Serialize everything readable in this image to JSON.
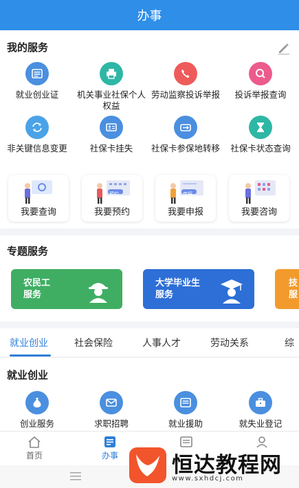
{
  "header": {
    "title": "办事"
  },
  "my_services": {
    "title": "我的服务",
    "items": [
      {
        "label": "就业创业证",
        "icon": "id-card-icon",
        "color": "#4a8fe0"
      },
      {
        "label": "机关事业社保个人权益",
        "icon": "printer-icon",
        "color": "#2fb7a6"
      },
      {
        "label": "劳动监察投诉举报",
        "icon": "phone-icon",
        "color": "#ef5b5b"
      },
      {
        "label": "投诉举报查询",
        "icon": "search-icon",
        "color": "#ec5b8c"
      },
      {
        "label": "非关键信息变更",
        "icon": "refresh-icon",
        "color": "#4aa3e8"
      },
      {
        "label": "社保卡挂失",
        "icon": "card-user-icon",
        "color": "#4a8fe0"
      },
      {
        "label": "社保卡参保地转移",
        "icon": "transfer-icon",
        "color": "#4a8fe0"
      },
      {
        "label": "社保卡状态查询",
        "icon": "hourglass-icon",
        "color": "#2fb7a6"
      }
    ],
    "quick": [
      {
        "label": "我要查询",
        "tag": ""
      },
      {
        "label": "我要预约",
        "tag": "预约"
      },
      {
        "label": "我要申报",
        "tag": "申报"
      },
      {
        "label": "我要咨询",
        "tag": ""
      }
    ]
  },
  "special_services": {
    "title": "专题服务",
    "banners": [
      {
        "line1": "农民工",
        "line2": "服务",
        "color": "#3fae63"
      },
      {
        "line1": "大学毕业生",
        "line2": "服务",
        "color": "#2d6fd6"
      },
      {
        "line1": "技",
        "line2": "服",
        "color": "#f39a2c"
      }
    ]
  },
  "tabs": [
    {
      "label": "就业创业",
      "active": true
    },
    {
      "label": "社会保险",
      "active": false
    },
    {
      "label": "人事人才",
      "active": false
    },
    {
      "label": "劳动关系",
      "active": false
    },
    {
      "label": "综",
      "active": false
    }
  ],
  "employment": {
    "title": "就业创业",
    "items": [
      {
        "label": "创业服务",
        "icon": "money-bag-icon",
        "color": "#4a8fe0"
      },
      {
        "label": "求职招聘",
        "icon": "envelope-icon",
        "color": "#4a8fe0"
      },
      {
        "label": "就业援助",
        "icon": "document-icon",
        "color": "#4a8fe0"
      },
      {
        "label": "就失业登记",
        "icon": "briefcase-icon",
        "color": "#4a8fe0"
      }
    ]
  },
  "bottom_nav": [
    {
      "label": "首页",
      "icon": "home-icon",
      "active": false
    },
    {
      "label": "办事",
      "icon": "tasks-icon",
      "active": true
    },
    {
      "label": "",
      "icon": "news-icon",
      "active": false
    },
    {
      "label": "",
      "icon": "user-icon",
      "active": false
    }
  ],
  "watermark": {
    "title": "恒达教程网",
    "url": "www.sxhdcj.com",
    "color": "#f2552c"
  },
  "colors": {
    "primary": "#2f8ee8",
    "accent": "#2f7fd8"
  }
}
